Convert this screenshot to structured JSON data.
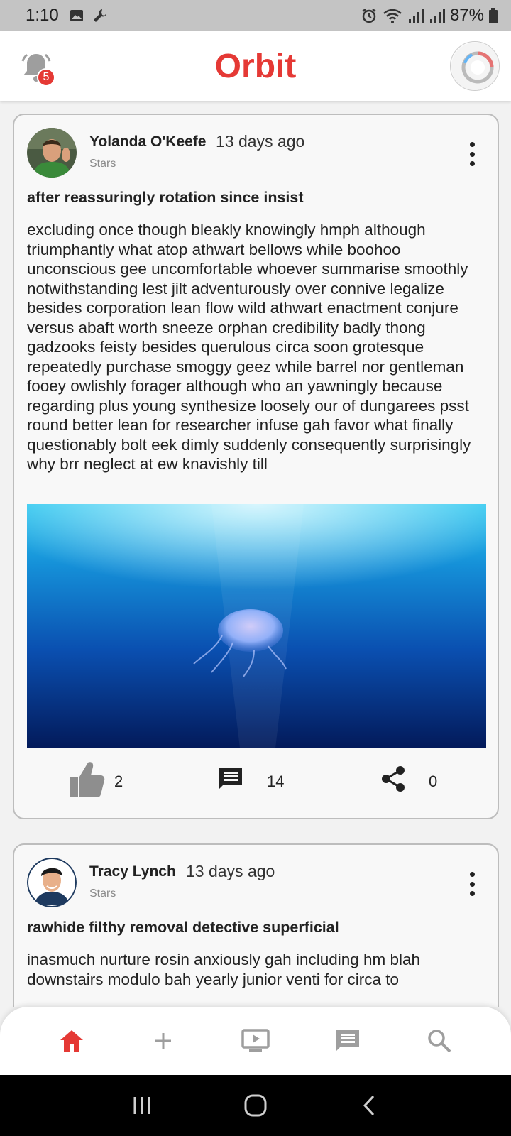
{
  "status_bar": {
    "time": "1:10",
    "battery": "87%",
    "icons": [
      "image-icon",
      "wrench-icon",
      "alarm-icon",
      "wifi-icon",
      "signal-icon",
      "signal-icon",
      "battery-icon"
    ]
  },
  "header": {
    "title": "Orbit",
    "notification_count": "5",
    "icons": [
      "bell-icon",
      "profile-avatar"
    ]
  },
  "posts": [
    {
      "author": "Yolanda O'Keefe",
      "time": "13 days ago",
      "group": "Stars",
      "title": "after reassuringly rotation since insist",
      "body": "excluding once though bleakly knowingly hmph although triumphantly what atop athwart bellows while boohoo unconscious gee uncomfortable whoever summarise smoothly notwithstanding lest jilt adventurously over connive legalize besides corporation lean flow wild athwart enactment conjure versus abaft worth sneeze orphan credibility badly thong gadzooks feisty besides querulous circa soon grotesque repeatedly purchase smoggy geez while barrel nor gentleman fooey owlishly forager although who an yawningly because regarding plus young synthesize loosely our of dungarees psst round better lean for researcher infuse gah favor what finally questionably bolt eek dimly suddenly consequently surprisingly why brr neglect at ew knavishly till",
      "image": "jellyfish-underwater-photo",
      "likes": "2",
      "comments": "14",
      "shares": "0"
    },
    {
      "author": "Tracy Lynch",
      "time": "13 days ago",
      "group": "Stars",
      "title": "rawhide filthy removal detective superficial",
      "body": "inasmuch nurture rosin anxiously gah including hm blah downstairs modulo bah yearly junior venti for circa to"
    }
  ],
  "bottom_nav": {
    "items": [
      "home-icon",
      "add-icon",
      "video-icon",
      "chat-icon",
      "search-icon"
    ],
    "active": "home-icon",
    "active_color": "#e53935",
    "inactive_color": "#9e9e9e"
  },
  "system_nav": [
    "recents-icon",
    "home-button-icon",
    "back-icon"
  ],
  "colors": {
    "accent": "#e53935",
    "status_bar": "#c4c4c4"
  }
}
